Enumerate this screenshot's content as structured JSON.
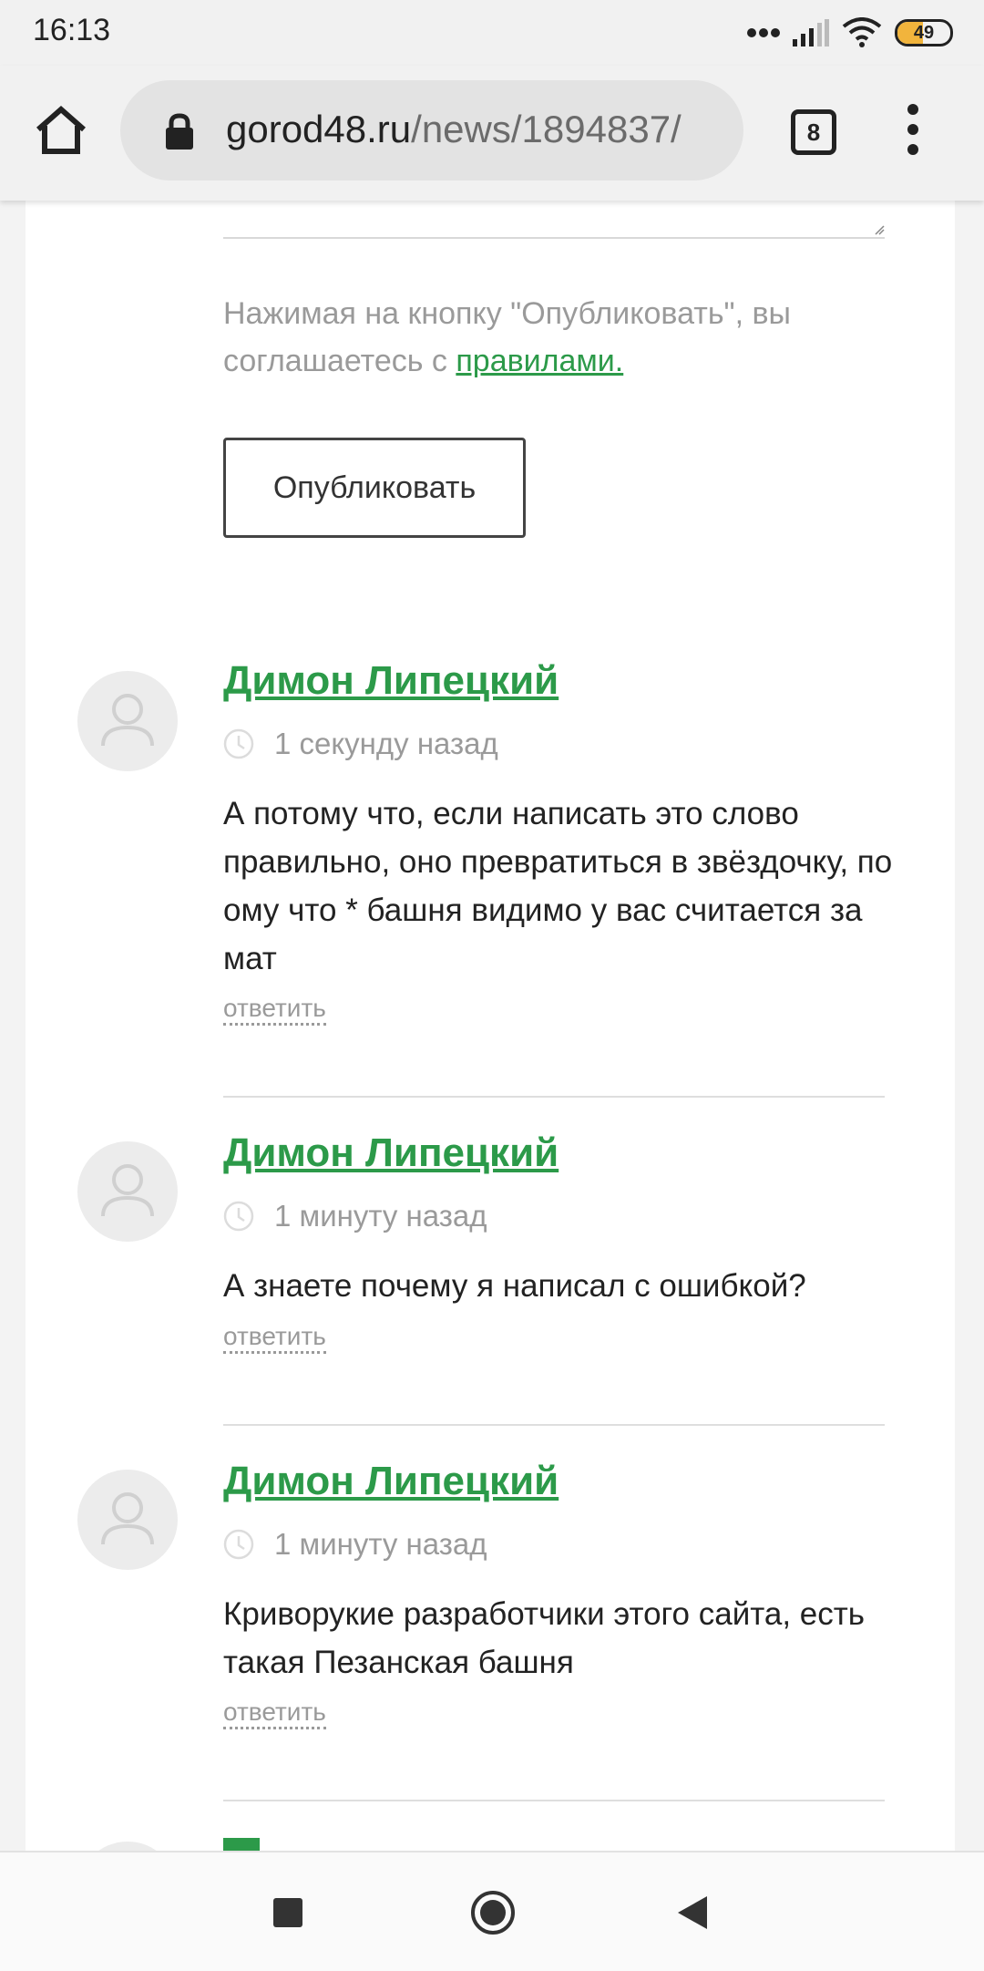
{
  "status_bar": {
    "time": "16:13",
    "battery_level": "49",
    "battery_fraction": 0.49,
    "accent_color": "#f1b43c"
  },
  "browser": {
    "url_domain": "gorod48.ru",
    "url_path": "/news/1894837/",
    "tab_count": "8",
    "icons": [
      "home-icon",
      "lock-icon",
      "tabs-icon",
      "menu-icon"
    ]
  },
  "form": {
    "consent_text": "Нажимая на кнопку \"Опубликовать\", вы соглашаетесь с ",
    "consent_link": "правилами.",
    "publish_label": "Опубликовать"
  },
  "comments": [
    {
      "author": "Димон Липецкий",
      "time": "1 секунду назад",
      "text": "А потому что, если написать это слово правильно, оно превратиться в звёздочку, по ому что * башня видимо у вас считается за мат",
      "reply_label": "ответить"
    },
    {
      "author": "Димон Липецкий",
      "time": "1 минуту назад",
      "text": "А знаете почему я написал с ошибкой?",
      "reply_label": "ответить"
    },
    {
      "author": "Димон Липецкий",
      "time": "1 минуту назад",
      "text": "Криворукие разработчики этого сайта, есть такая Пезанская башня",
      "reply_label": "ответить"
    }
  ],
  "colors": {
    "link_green": "#2c9a49",
    "muted_gray": "#9a9a9a"
  }
}
